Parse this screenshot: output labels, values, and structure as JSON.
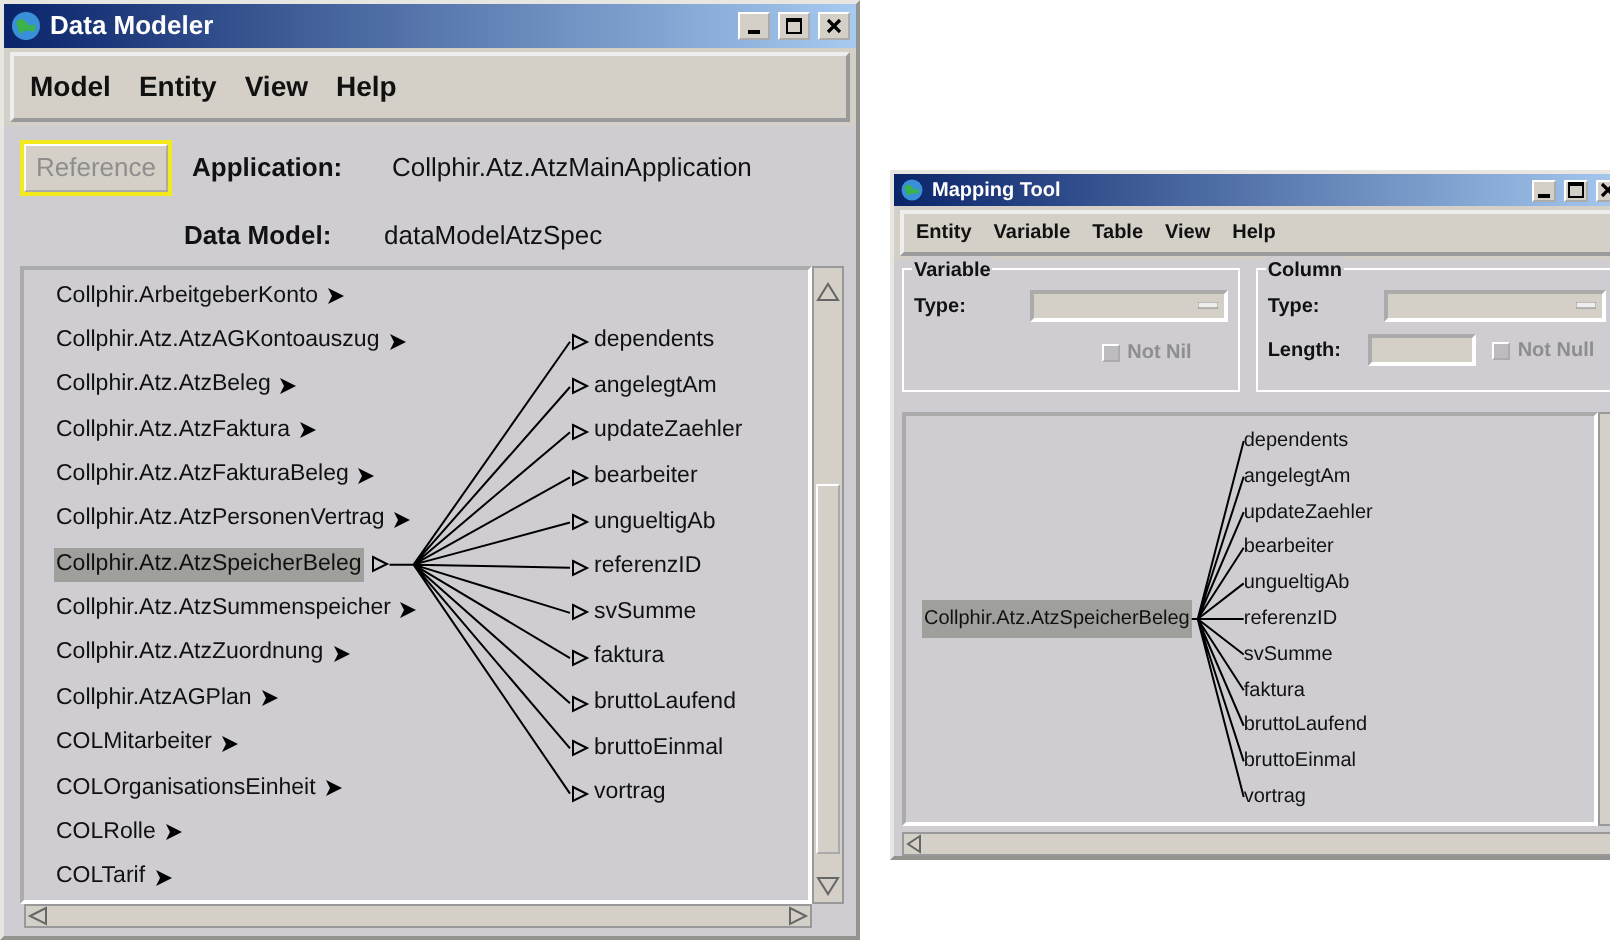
{
  "data_modeler": {
    "title": "Data Modeler",
    "menu": [
      "Model",
      "Entity",
      "View",
      "Help"
    ],
    "reference_button": {
      "label": "Reference",
      "disabled": true,
      "focused": true
    },
    "application": {
      "label": "Application:",
      "value": "Collphir.Atz.AtzMainApplication"
    },
    "data_model": {
      "label": "Data Model:",
      "value": "dataModelAtzSpec"
    },
    "entities": [
      {
        "name": "Collphir.ArbeitgeberKonto",
        "selected": false,
        "expanded": false
      },
      {
        "name": "Collphir.Atz.AtzAGKontoauszug",
        "selected": false,
        "expanded": false
      },
      {
        "name": "Collphir.Atz.AtzBeleg",
        "selected": false,
        "expanded": false
      },
      {
        "name": "Collphir.Atz.AtzFaktura",
        "selected": false,
        "expanded": false
      },
      {
        "name": "Collphir.Atz.AtzFakturaBeleg",
        "selected": false,
        "expanded": false
      },
      {
        "name": "Collphir.Atz.AtzPersonenVertrag",
        "selected": false,
        "expanded": false
      },
      {
        "name": "Collphir.Atz.AtzSpeicherBeleg",
        "selected": true,
        "expanded": true
      },
      {
        "name": "Collphir.Atz.AtzSummenspeicher",
        "selected": false,
        "expanded": false
      },
      {
        "name": "Collphir.Atz.AtzZuordnung",
        "selected": false,
        "expanded": false
      },
      {
        "name": "Collphir.AtzAGPlan",
        "selected": false,
        "expanded": false
      },
      {
        "name": "COLMitarbeiter",
        "selected": false,
        "expanded": false
      },
      {
        "name": "COLOrganisationsEinheit",
        "selected": false,
        "expanded": false
      },
      {
        "name": "COLRolle",
        "selected": false,
        "expanded": false
      },
      {
        "name": "COLTarif",
        "selected": false,
        "expanded": false
      }
    ],
    "attributes": [
      "dependents",
      "angelegtAm",
      "updateZaehler",
      "bearbeiter",
      "ungueltigAb",
      "referenzID",
      "svSumme",
      "faktura",
      "bruttoLaufend",
      "bruttoEinmal",
      "vortrag"
    ]
  },
  "mapping_tool": {
    "title": "Mapping Tool",
    "menu": [
      "Entity",
      "Variable",
      "Table",
      "View",
      "Help"
    ],
    "variable_group": {
      "title": "Variable",
      "type_label": "Type:",
      "not_nil": {
        "label": "Not Nil",
        "checked": false,
        "disabled": true
      }
    },
    "column_group": {
      "title": "Column",
      "type_label": "Type:",
      "length_label": "Length:",
      "not_null": {
        "label": "Not Null",
        "checked": false,
        "disabled": true
      }
    },
    "diagram": {
      "entity": "Collphir.Atz.AtzSpeicherBeleg",
      "entity_selected": true,
      "attributes": [
        "dependents",
        "angelegtAm",
        "updateZaehler",
        "bearbeiter",
        "ungueltigAb",
        "referenzID",
        "svSumme",
        "faktura",
        "bruttoLaufend",
        "bruttoEinmal",
        "vortrag"
      ]
    }
  }
}
